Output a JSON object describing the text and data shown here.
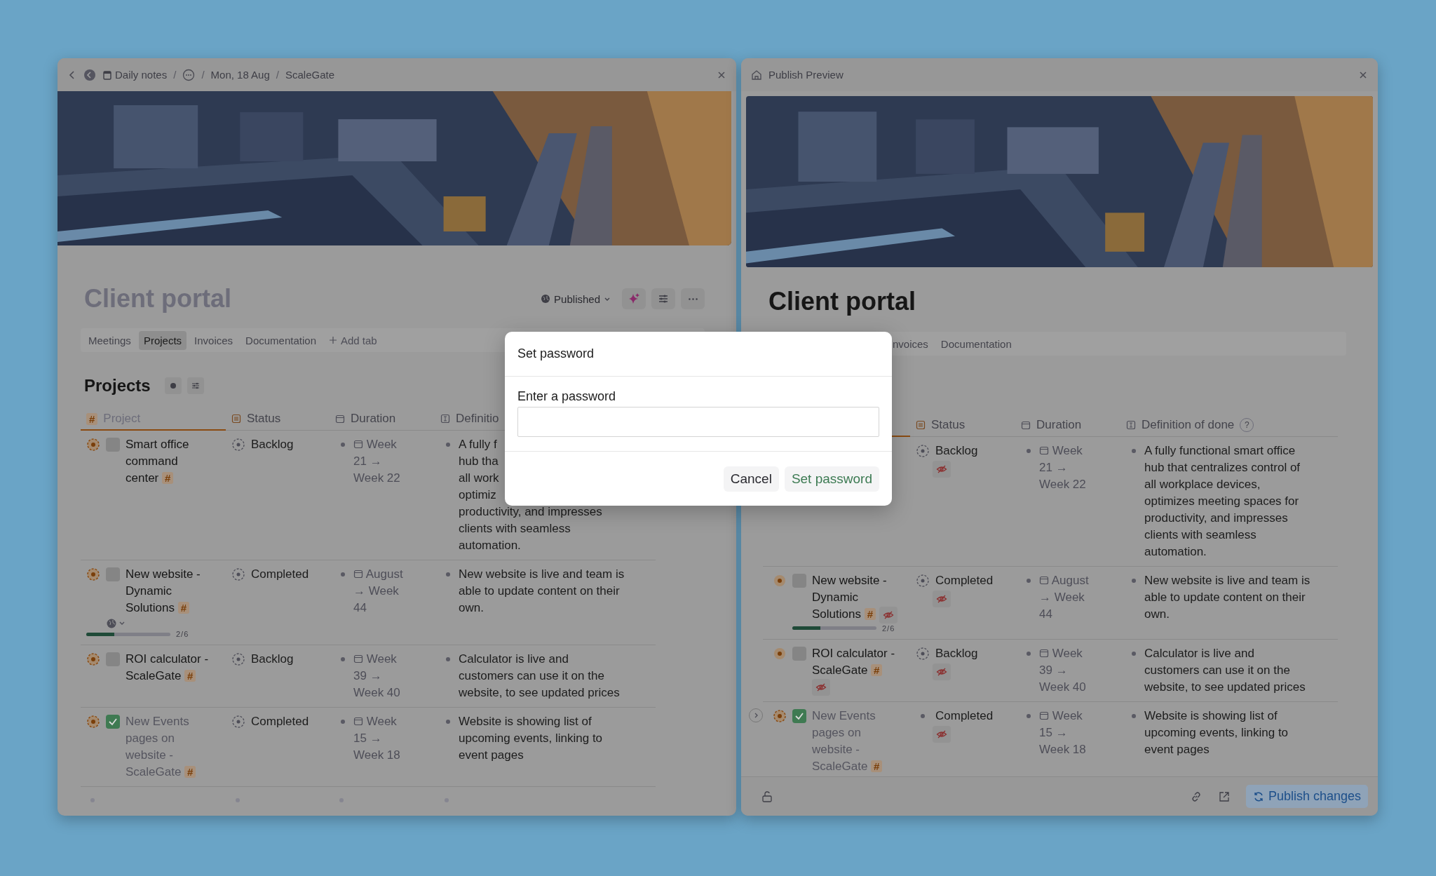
{
  "left_window": {
    "breadcrumb": [
      {
        "kind": "avatar"
      },
      {
        "kind": "page",
        "label": "Daily notes"
      },
      {
        "kind": "more"
      },
      {
        "kind": "text",
        "label": "Mon, 18 Aug"
      },
      {
        "kind": "text",
        "label": "ScaleGate"
      }
    ],
    "separator": "/",
    "title": "Client portal",
    "publish_status": "Published",
    "tabs": [
      {
        "label": "Meetings",
        "selected": false
      },
      {
        "label": "Projects",
        "selected": true
      },
      {
        "label": "Invoices",
        "selected": false
      },
      {
        "label": "Documentation",
        "selected": false
      }
    ],
    "add_tab": "Add tab",
    "section_title": "Projects",
    "columns": [
      {
        "kind": "hash",
        "badge": "#",
        "label": "Project"
      },
      {
        "kind": "select",
        "label": "Status"
      },
      {
        "kind": "date",
        "label": "Duration"
      },
      {
        "kind": "text",
        "label": "Definitio"
      }
    ],
    "rows": [
      {
        "name": "Smart office command center **#**",
        "checked": false,
        "status": "Backlog",
        "duration": "Week 21 → Week 22",
        "definition_lines": [
          "A fully f",
          "hub tha",
          "all work",
          "optimiz",
          "productivity, and impresses",
          "clients with seamless",
          "automation."
        ]
      },
      {
        "name": "New website - Dynamic Solutions **#**",
        "checked": false,
        "globe_menu": true,
        "progress": {
          "level": 0.33,
          "reading": "2/6"
        },
        "status": "Completed",
        "duration": "August → Week 44",
        "definition": "New website is live and team is able to update content on their own."
      },
      {
        "name": "ROI calculator - ScaleGate **#**",
        "checked": false,
        "status": "Backlog",
        "duration": "Week 39 → Week 40",
        "definition": "Calculator is live and customers can use it on the website, to see updated prices"
      },
      {
        "name": "New Events pages on website - ScaleGate **#**",
        "checked": true,
        "status": "Completed",
        "duration": "Week 15 → Week 18",
        "definition": "Website is showing list of upcoming events, linking to event pages"
      }
    ]
  },
  "right_window": {
    "title": "Publish Preview",
    "page_title": "Client portal",
    "tabs": [
      {
        "label": "nvoices",
        "selected": false
      },
      {
        "label": "Documentation",
        "selected": false
      }
    ],
    "columns": [
      {
        "kind": "select",
        "label": "Status"
      },
      {
        "kind": "date",
        "label": "Duration"
      },
      {
        "kind": "text",
        "label": "Definition of done",
        "help": "?"
      }
    ],
    "rows": [
      {
        "status": "Backlog",
        "status_hidden": true,
        "duration": "Week 21 → Week 22",
        "definition": "A fully functional smart office hub that centralizes control of all workplace devices, optimizes meeting spaces for productivity, and impresses clients with seamless automation."
      },
      {
        "expandable": false,
        "name": "New website - Dynamic Solutions **#**",
        "checked": false,
        "name_hidden": true,
        "progress": {
          "level": 0.33,
          "reading": "2/6"
        },
        "status": "Completed",
        "status_hidden": true,
        "duration": "August → Week 44",
        "definition": "New website is live and team is able to update content on their own."
      },
      {
        "expandable": false,
        "name": "ROI calculator - ScaleGate **#**",
        "checked": false,
        "name_hidden": true,
        "status": "Backlog",
        "status_hidden": true,
        "duration": "Week 39 → Week 40",
        "definition": "Calculator is live and customers can use it on the website, to see updated prices"
      },
      {
        "expandable": true,
        "expanded": false,
        "name": "New Events pages on website - ScaleGate **#**",
        "checked": true,
        "status": "Completed",
        "status_hidden": true,
        "duration": "Week 15 → Week 18",
        "definition": "Website is showing list of upcoming events, linking to event pages"
      }
    ],
    "publish_button": "Publish changes"
  },
  "dialog": {
    "title": "Set password",
    "field_label": "Enter a password",
    "buttons": [
      {
        "label": "Cancel",
        "kind": "secondary"
      },
      {
        "label": "Set password",
        "kind": "primary"
      }
    ]
  }
}
